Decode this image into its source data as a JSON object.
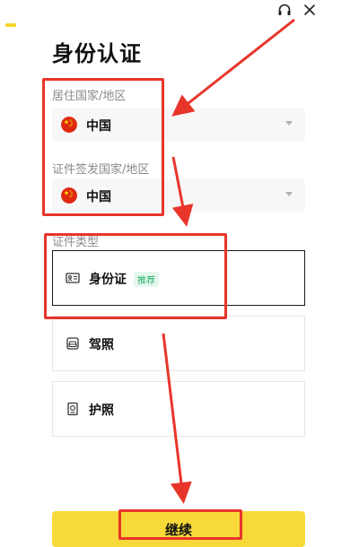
{
  "page": {
    "title": "身份认证"
  },
  "fields": {
    "residence": {
      "label": "居住国家/地区",
      "value": "中国"
    },
    "issuing": {
      "label": "证件签发国家/地区",
      "value": "中国"
    }
  },
  "document_type": {
    "label": "证件类型",
    "options": [
      {
        "label": "身份证",
        "badge": "推荐",
        "icon": "id-card-icon"
      },
      {
        "label": "驾照",
        "icon": "drivers-license-icon"
      },
      {
        "label": "护照",
        "icon": "passport-icon"
      }
    ]
  },
  "actions": {
    "continue_label": "继续"
  },
  "colors": {
    "accent": "#f7d93a",
    "annotation": "#e8352a",
    "badge_text": "#27b36a"
  }
}
